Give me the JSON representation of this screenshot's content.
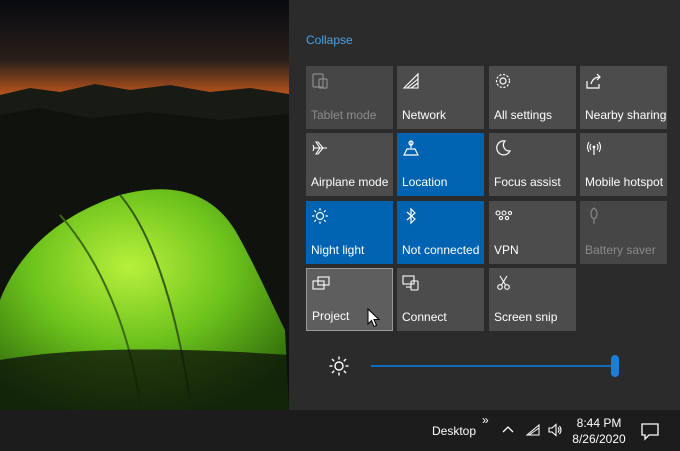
{
  "action_center": {
    "collapse_label": "Collapse",
    "tiles": [
      {
        "label": "Tablet mode",
        "icon": "tablet-icon",
        "state": "disabled"
      },
      {
        "label": "Network",
        "icon": "network-icon",
        "state": "off"
      },
      {
        "label": "All settings",
        "icon": "gear-icon",
        "state": "off"
      },
      {
        "label": "Nearby sharing",
        "icon": "share-icon",
        "state": "off"
      },
      {
        "label": "Airplane mode",
        "icon": "airplane-icon",
        "state": "off"
      },
      {
        "label": "Location",
        "icon": "location-icon",
        "state": "on"
      },
      {
        "label": "Focus assist",
        "icon": "moon-icon",
        "state": "off"
      },
      {
        "label": "Mobile hotspot",
        "icon": "hotspot-icon",
        "state": "off"
      },
      {
        "label": "Night light",
        "icon": "brightness-icon",
        "state": "on"
      },
      {
        "label": "Not connected",
        "icon": "bluetooth-icon",
        "state": "on"
      },
      {
        "label": "VPN",
        "icon": "vpn-icon",
        "state": "off"
      },
      {
        "label": "Battery saver",
        "icon": "battery-saver-icon",
        "state": "disabled"
      },
      {
        "label": "Project",
        "icon": "project-icon",
        "state": "hover"
      },
      {
        "label": "Connect",
        "icon": "connect-icon",
        "state": "off"
      },
      {
        "label": "Screen snip",
        "icon": "screen-snip-icon",
        "state": "off"
      }
    ],
    "brightness": {
      "icon": "brightness-icon",
      "level": 1.0
    }
  },
  "taskbar": {
    "desktop_label": "Desktop",
    "overflow_glyph": "»",
    "time": "8:44 PM",
    "date": "8/26/2020",
    "tray_icons": [
      "chevron-up-icon",
      "wifi-icon",
      "volume-icon"
    ],
    "notification_icon": "notification-icon"
  },
  "colors": {
    "panel": "#2b2b2b",
    "tile": "#4c4c4c",
    "tile_on": "#0063b1",
    "link": "#4aa3e8",
    "taskbar": "#1c1c1c"
  }
}
